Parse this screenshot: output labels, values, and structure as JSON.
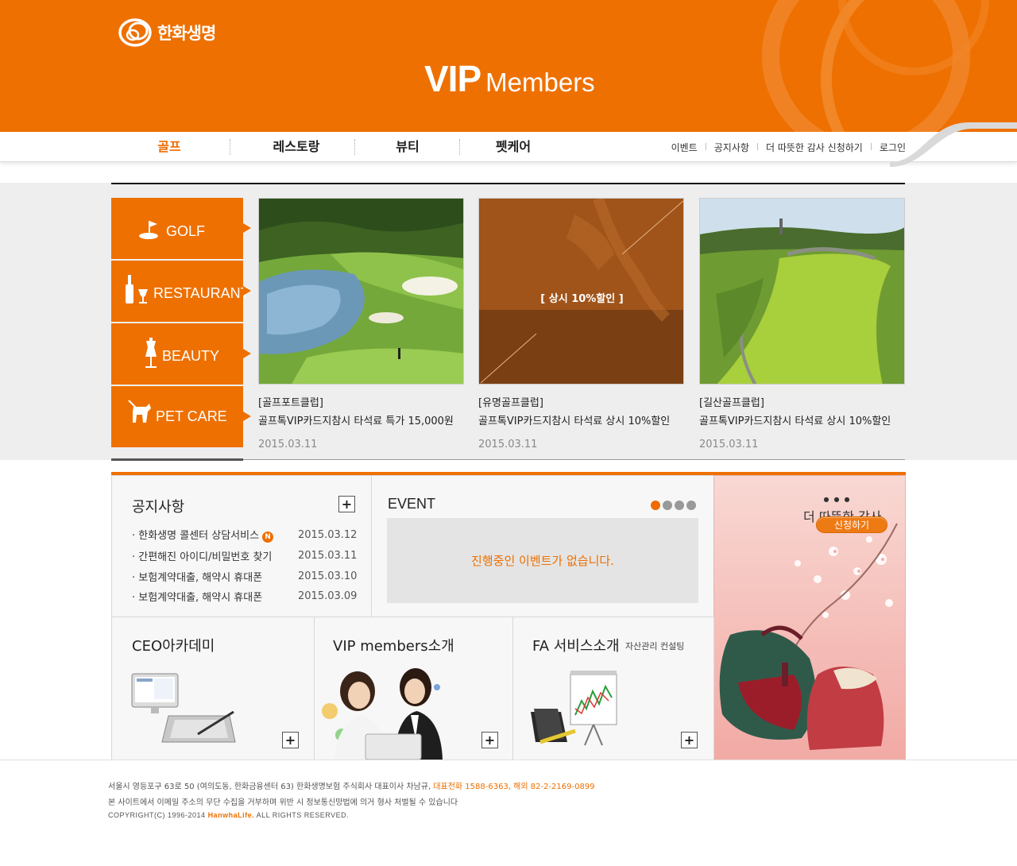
{
  "header": {
    "logo_text": "한화생명",
    "title_vip": "VIP",
    "title_members": "Members"
  },
  "nav": {
    "main": [
      {
        "label": "골프",
        "active": true
      },
      {
        "label": "레스토랑",
        "active": false
      },
      {
        "label": "뷰티",
        "active": false
      },
      {
        "label": "펫케어",
        "active": false
      }
    ],
    "util": [
      "이벤트",
      "공지사항",
      "더 따뜻한 감사 신청하기",
      "로그인"
    ]
  },
  "categories": [
    {
      "label": "GOLF",
      "icon": "golf-icon"
    },
    {
      "label": "RESTAURANT",
      "icon": "wine-icon"
    },
    {
      "label": "BEAUTY",
      "icon": "dress-form-icon"
    },
    {
      "label": "PET CARE",
      "icon": "dog-icon"
    }
  ],
  "cards": [
    {
      "club": "[골프포트클럽]",
      "desc": "골프톡VIP카드지참시 타석료 특가 15,000원",
      "date": "2015.03.11",
      "overlay": ""
    },
    {
      "club": "[유명골프클럽]",
      "desc": "골프톡VIP카드지참시 타석료 상시 10%할인",
      "date": "2015.03.11",
      "overlay": "[ 상시 10%할인 ]"
    },
    {
      "club": "[길산골프클럽]",
      "desc": "골프톡VIP카드지참시 타석료 상시 10%할인",
      "date": "2015.03.11",
      "overlay": ""
    }
  ],
  "notice": {
    "title": "공지사항",
    "new_badge": "N",
    "items": [
      {
        "text": "· 한화생명 콜센터 상담서비스",
        "date": "2015.03.12",
        "is_new": true
      },
      {
        "text": "· 간편해진 아이디/비밀번호 찾기",
        "date": "2015.03.11",
        "is_new": false
      },
      {
        "text": "· 보험계약대출, 해약시 휴대폰",
        "date": "2015.03.10",
        "is_new": false
      },
      {
        "text": "· 보험계약대출, 해약시 휴대폰",
        "date": "2015.03.09",
        "is_new": false
      }
    ]
  },
  "event": {
    "title": "EVENT",
    "empty_message": "진행중인 이벤트가 없습니다.",
    "dots": 4,
    "active_dot": 0
  },
  "promo": {
    "title": "더 따뜻한 감사",
    "button": "신청하기"
  },
  "bottom_boxes": [
    {
      "title": "CEO아카데미",
      "subtitle": ""
    },
    {
      "title": "VIP members소개",
      "subtitle": ""
    },
    {
      "title": "FA 서비스소개",
      "subtitle": "자산관리 컨설팅"
    }
  ],
  "footer": {
    "line1_a": "서울시 영등포구 63로 50 (여의도동, 한화금융센터 63) 한화생명보험 주식회사 대표이사 차남규,",
    "line1_b": "대표전화 1588-6363, 해외 82-2-2169-0899",
    "line2": "본 사이트에서 이메일 주소의 무단 수집을 거부하며 위반 시 정보통신망법에 의거 형사 처벌될 수 있습니다",
    "line3_a": "COPYRIGHT(C) 1996-2014",
    "line3_b": "HanwhaLife.",
    "line3_c": "ALL RIGHTS RESERVED."
  },
  "colors": {
    "brand_orange": "#ee7000",
    "band_gray": "#eeeeee",
    "text_dark": "#222222"
  }
}
